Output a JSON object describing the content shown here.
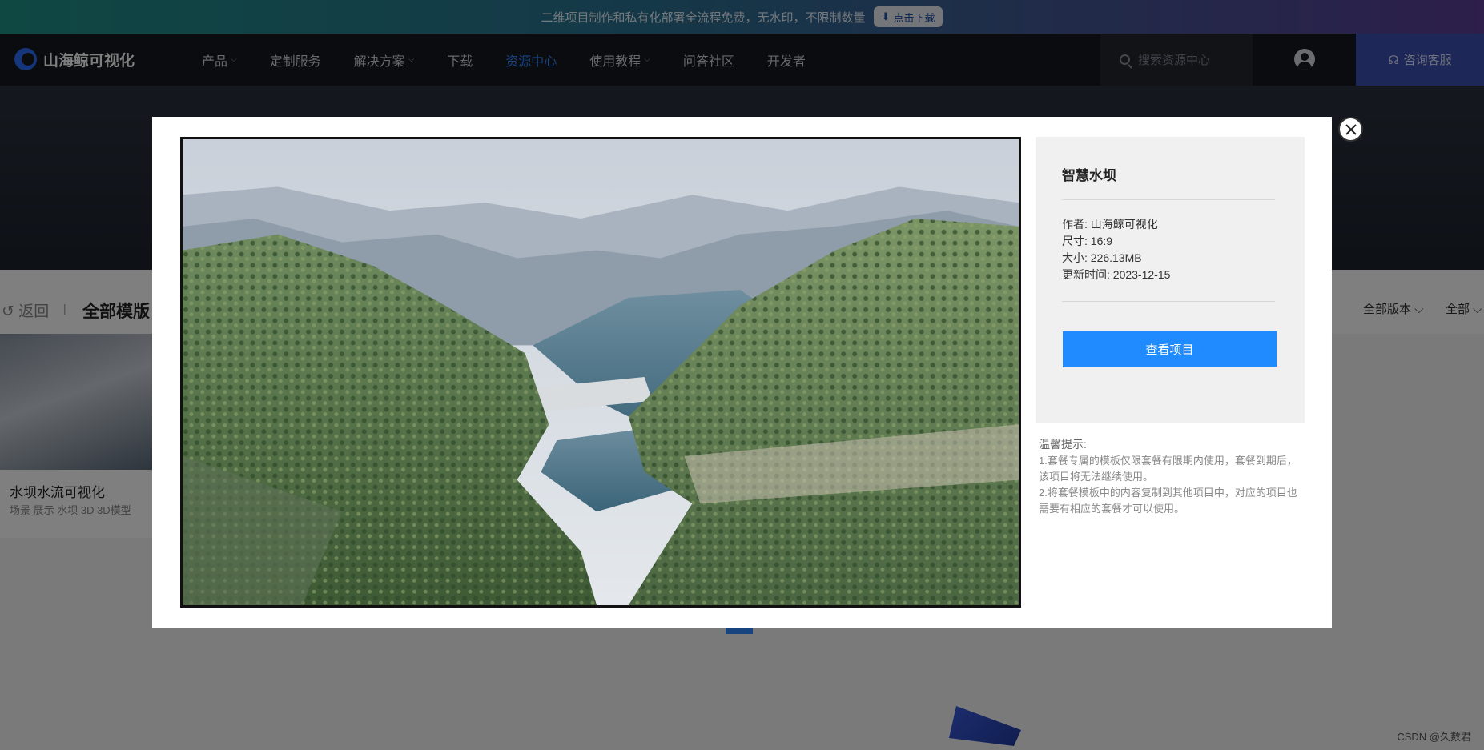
{
  "promo": {
    "text": "二维项目制作和私有化部署全流程免费，无水印，不限制数量",
    "button_label": "点击下载"
  },
  "nav": {
    "logo_text": "山海鲸可视化",
    "items": [
      {
        "label": "产品",
        "has_caret": true
      },
      {
        "label": "定制服务",
        "has_caret": false
      },
      {
        "label": "解决方案",
        "has_caret": true
      },
      {
        "label": "下载",
        "has_caret": false
      },
      {
        "label": "资源中心",
        "has_caret": false,
        "active": true
      },
      {
        "label": "使用教程",
        "has_caret": true
      },
      {
        "label": "问答社区",
        "has_caret": false
      },
      {
        "label": "开发者",
        "has_caret": false
      }
    ],
    "search_placeholder": "搜索资源中心",
    "consult_label": "咨询客服"
  },
  "filters": {
    "back_label": "返回",
    "separator": "|",
    "section_title": "全部模版",
    "version_filter": "全部版本",
    "all_filter": "全部"
  },
  "card": {
    "title": "水坝水流可视化",
    "tags": "场景 展示 水坝 3D 3D模型"
  },
  "modal": {
    "project": {
      "title": "智慧水坝",
      "author": "作者: 山海鲸可视化",
      "size_ratio": "尺寸: 16:9",
      "file_size": "大小: 226.13MB",
      "updated": "更新时间: 2023-12-15"
    },
    "view_button_label": "查看项目",
    "tips": {
      "title": "温馨提示:",
      "line1": "1.套餐专属的模板仅限套餐有限期内使用，套餐到期后，该项目将无法继续使用。",
      "line2": "2.将套餐模板中的内容复制到其他项目中，对应的项目也需要有相应的套餐才可以使用。"
    }
  },
  "watermark": "CSDN @久数君",
  "colors": {
    "accent": "#1f8bff",
    "nav_bg": "#16191f",
    "consult_bg": "#3b4fb0"
  }
}
